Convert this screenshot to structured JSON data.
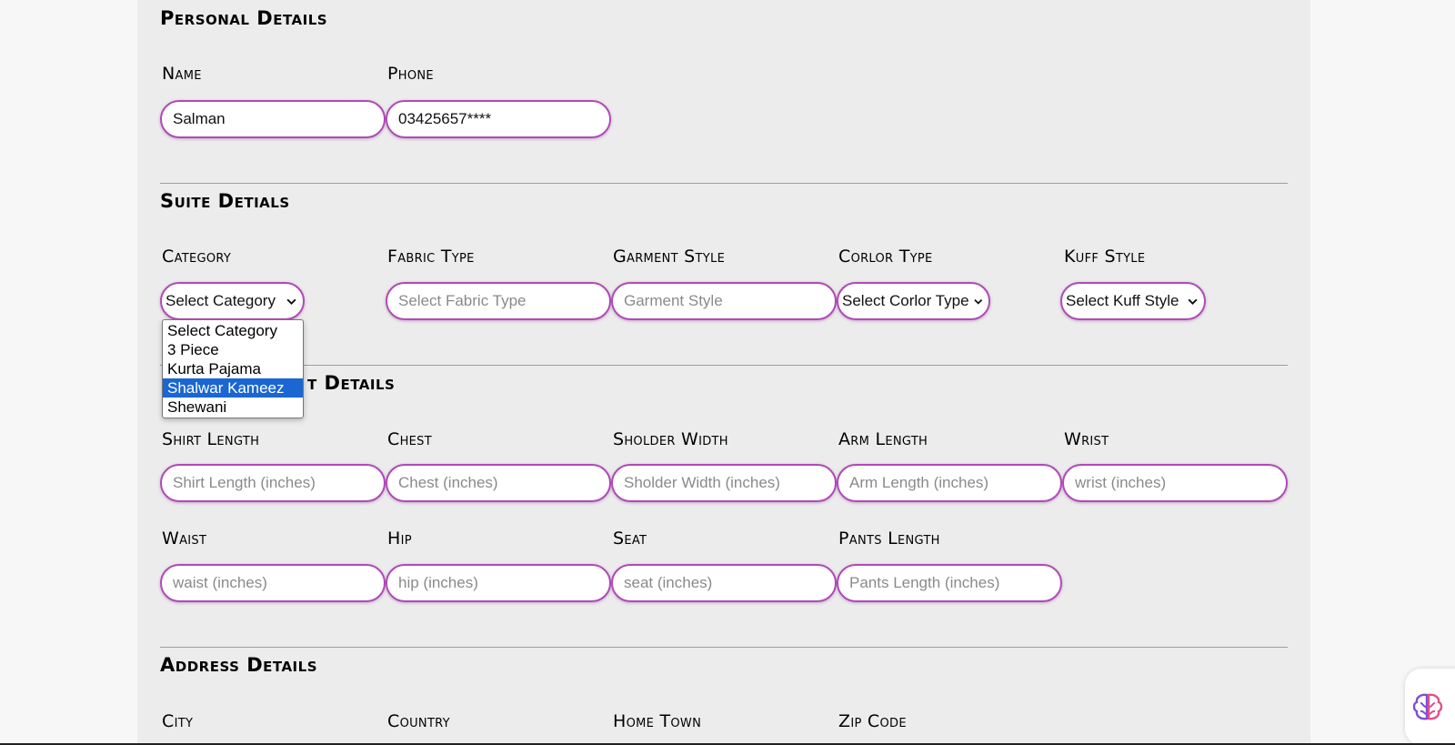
{
  "personal": {
    "title": "Personal Details",
    "name_label": "Name",
    "name_value": "Salman",
    "phone_label": "Phone",
    "phone_value": "03425657****"
  },
  "suite": {
    "title": "Suite Detials",
    "category_label": "Category",
    "category_selected": "Select Category",
    "fabric_label": "Fabric Type",
    "fabric_placeholder": "Select Fabric Type",
    "garment_label": "Garment Style",
    "garment_placeholder": "Garment Style",
    "color_label": "Corlor Type",
    "color_selected": "Select Corlor Type",
    "kuff_label": "Kuff Style",
    "kuff_selected": "Select Kuff Style"
  },
  "category_dropdown": {
    "options": [
      "Select Category",
      "3 Piece",
      "Kurta Pajama",
      "Shalwar Kameez",
      "Shewani"
    ],
    "highlighted": "Shalwar Kameez"
  },
  "measurement": {
    "title_visible": "t Details",
    "shirt_length_label": "Shirt Length",
    "shirt_length_placeholder": "Shirt Length (inches)",
    "chest_label": "Chest",
    "chest_placeholder": "Chest (inches)",
    "sholder_label": "Sholder Width",
    "sholder_placeholder": "Sholder Width (inches)",
    "arm_label": "Arm Length",
    "arm_placeholder": "Arm Length (inches)",
    "wrist_label": "Wrist",
    "wrist_placeholder": "wrist (inches)",
    "waist_label": "Waist",
    "waist_placeholder": "waist (inches)",
    "hip_label": "Hip",
    "hip_placeholder": "hip (inches)",
    "seat_label": "Seat",
    "seat_placeholder": "seat (inches)",
    "pants_label": "Pants Length",
    "pants_placeholder": "Pants Length (inches)"
  },
  "address": {
    "title": "Address Details",
    "city_label": "City",
    "country_label": "Country",
    "hometown_label": "Home Town",
    "zip_label": "Zip Code"
  },
  "colors": {
    "input_border": "#b04ab8",
    "panel_bg": "#ececec",
    "highlight": "#1a66d2"
  },
  "icons": {
    "select_arrow": "chevron-down-icon",
    "assistant": "brain-icon"
  }
}
